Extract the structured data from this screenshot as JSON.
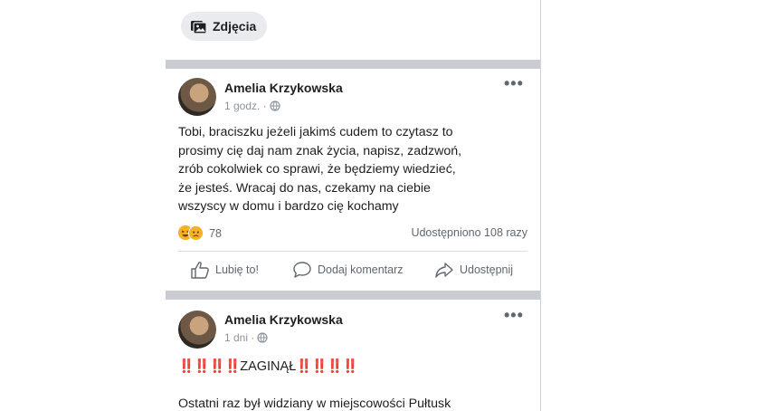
{
  "top": {
    "photos_label": "Zdjęcia"
  },
  "post1": {
    "author": "Amelia Krzykowska",
    "time": "1 godz. ·",
    "text_lines": [
      "Tobi, braciszku jeżeli jakimś cudem to czytasz to",
      "prosimy cię daj nam znak życia, napisz, zadzwoń,",
      "zrób cokolwiek co sprawi, że będziemy wiedzieć,",
      "że jesteś. Wracaj do nas, czekamy na ciebie",
      "wszyscy w domu i bardzo cię kochamy"
    ],
    "reaction_count": "78",
    "shares": "Udostępniono 108 razy",
    "actions": {
      "like": "Lubię to!",
      "comment": "Dodaj komentarz",
      "share": "Udostępnij"
    }
  },
  "post2": {
    "author": "Amelia Krzykowska",
    "time": "1 dni ·",
    "headline_prefix": "‼️‼️‼️‼️",
    "headline_word": "ZAGINĄŁ",
    "headline_suffix": "‼️‼️‼️‼️",
    "text_line": "Ostatni raz był widziany w miejscowości Pułtusk"
  },
  "colors": {
    "separator": "#c9ccd1",
    "secondary_text": "#606770",
    "alert_red": "#e0162b"
  },
  "icons": [
    "photos-icon",
    "globe-icon",
    "more-icon",
    "like-icon",
    "comment-icon",
    "share-icon",
    "haha-reaction-icon",
    "sad-reaction-icon"
  ]
}
